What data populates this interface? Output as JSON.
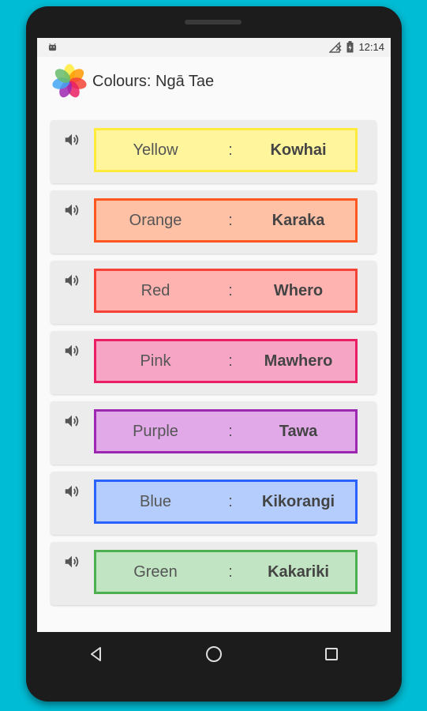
{
  "status_bar": {
    "time": "12:14",
    "icons": [
      "android-notification-icon",
      "no-signal-icon",
      "battery-charging-icon"
    ]
  },
  "app": {
    "title": "Colours: Ngā Tae",
    "logo": "flower-petals-logo-icon"
  },
  "colours": [
    {
      "english": "Yellow",
      "separator": ":",
      "maori": "Kowhai",
      "fill": "#fff59d",
      "border": "#ffeb3b"
    },
    {
      "english": "Orange",
      "separator": ":",
      "maori": "Karaka",
      "fill": "#ffc1a6",
      "border": "#ff5722"
    },
    {
      "english": "Red",
      "separator": ":",
      "maori": "Whero",
      "fill": "#ffb3b0",
      "border": "#f44336"
    },
    {
      "english": "Pink",
      "separator": ":",
      "maori": "Mawhero",
      "fill": "#f6a6c4",
      "border": "#e91e63"
    },
    {
      "english": "Purple",
      "separator": ":",
      "maori": "Tawa",
      "fill": "#e1a9e8",
      "border": "#9c27b0"
    },
    {
      "english": "Blue",
      "separator": ":",
      "maori": "Kikorangi",
      "fill": "#b4cdfd",
      "border": "#2962ff"
    },
    {
      "english": "Green",
      "separator": ":",
      "maori": "Kakariki",
      "fill": "#c1e4c2",
      "border": "#4caf50"
    }
  ],
  "item_icon": "speaker-volume-icon",
  "nav": {
    "back_icon": "back-triangle-icon",
    "home_icon": "home-circle-icon",
    "recents_icon": "recents-square-icon"
  }
}
